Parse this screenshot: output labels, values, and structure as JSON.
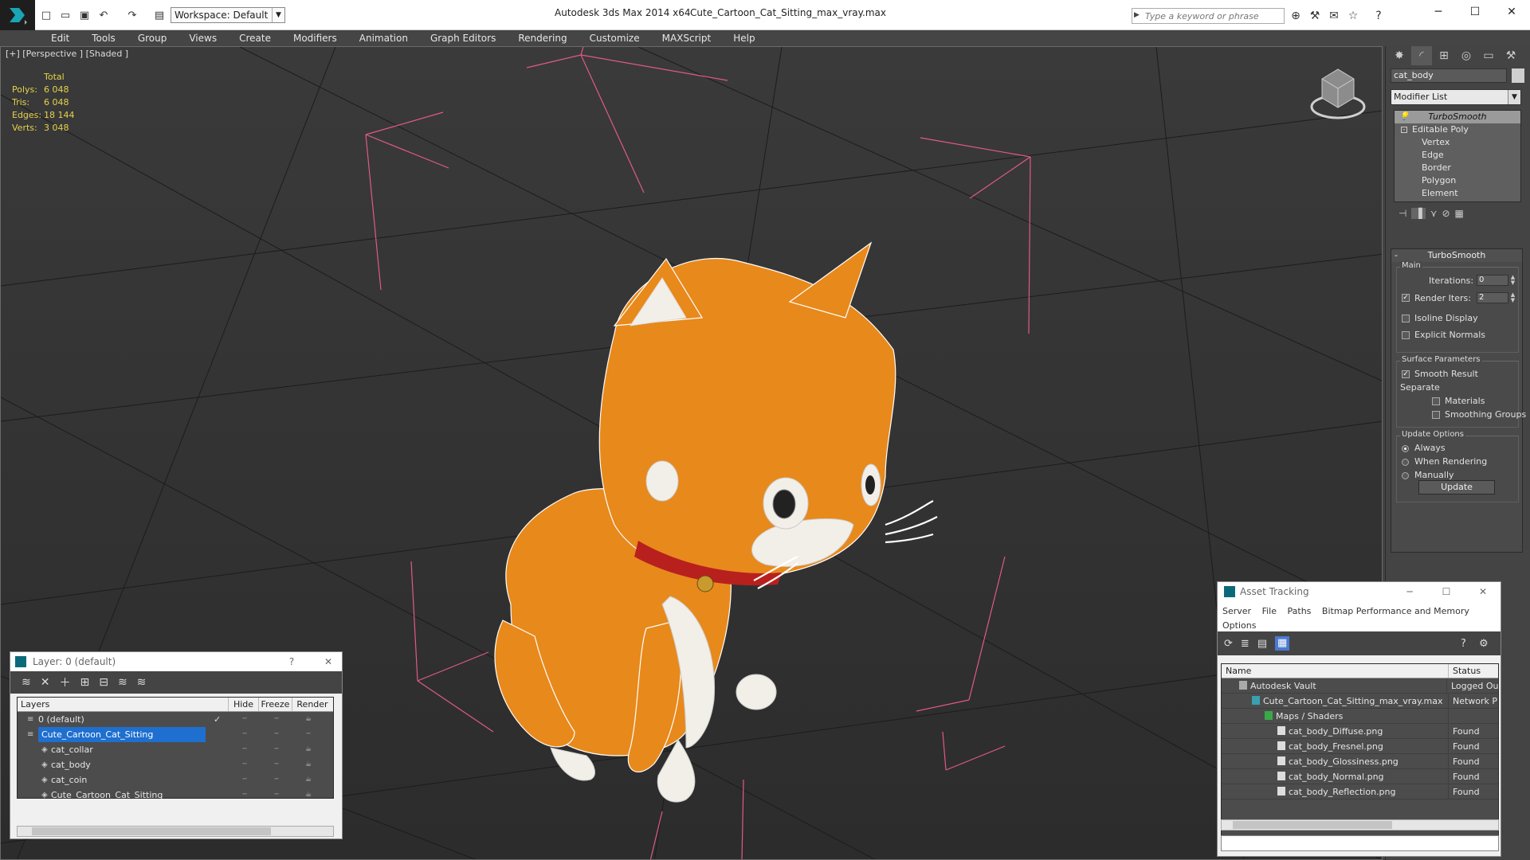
{
  "title_bar": {
    "app_title": "Autodesk 3ds Max  2014 x64",
    "file_title": "Cute_Cartoon_Cat_Sitting_max_vray.max",
    "workspace": "Workspace: Default",
    "search_placeholder": "Type a keyword or phrase"
  },
  "menu": [
    "Edit",
    "Tools",
    "Group",
    "Views",
    "Create",
    "Modifiers",
    "Animation",
    "Graph Editors",
    "Rendering",
    "Customize",
    "MAXScript",
    "Help"
  ],
  "viewport": {
    "label": "[+] [Perspective ] [Shaded ]",
    "stats": {
      "header": "Total",
      "rows": [
        {
          "k": "Polys:",
          "v": "6 048"
        },
        {
          "k": "Tris:",
          "v": "6 048"
        },
        {
          "k": "Edges:",
          "v": "18 144"
        },
        {
          "k": "Verts:",
          "v": "3 048"
        }
      ]
    }
  },
  "command_panel": {
    "object_name": "cat_body",
    "modifier_list": "Modifier List",
    "stack": {
      "selected": "TurboSmooth",
      "base": "Editable Poly",
      "subs": [
        "Vertex",
        "Edge",
        "Border",
        "Polygon",
        "Element"
      ]
    },
    "turbosmooth": {
      "title": "TurboSmooth",
      "main_group": "Main",
      "iterations_label": "Iterations:",
      "iterations_value": "0",
      "render_iters_label": "Render Iters:",
      "render_iters_value": "2",
      "isoline_label": "Isoline Display",
      "explicit_normals_label": "Explicit Normals",
      "surface_group": "Surface Parameters",
      "smooth_result_label": "Smooth Result",
      "separate_label": "Separate",
      "materials_label": "Materials",
      "smoothing_groups_label": "Smoothing Groups",
      "update_group": "Update Options",
      "always_label": "Always",
      "when_rendering_label": "When Rendering",
      "manually_label": "Manually",
      "update_button": "Update"
    }
  },
  "layer_window": {
    "title": "Layer: 0 (default)",
    "columns": [
      "Layers",
      "Hide",
      "Freeze",
      "Render"
    ],
    "rows": [
      {
        "name": "0 (default)",
        "child": false
      },
      {
        "name": "Cute_Cartoon_Cat_Sitting",
        "child": false
      },
      {
        "name": "cat_collar",
        "child": true
      },
      {
        "name": "cat_body",
        "child": true
      },
      {
        "name": "cat_coin",
        "child": true
      },
      {
        "name": "Cute_Cartoon_Cat_Sitting",
        "child": true
      }
    ]
  },
  "asset_window": {
    "title": "Asset Tracking",
    "menu": [
      "Server",
      "File",
      "Paths",
      "Bitmap Performance and Memory",
      "Options"
    ],
    "columns": [
      "Name",
      "Status"
    ],
    "rows": [
      {
        "name": "Autodesk Vault",
        "status": "Logged Ou",
        "indent": 1,
        "icon": "vault"
      },
      {
        "name": "Cute_Cartoon_Cat_Sitting_max_vray.max",
        "status": "Network P",
        "indent": 2,
        "icon": "max"
      },
      {
        "name": "Maps / Shaders",
        "status": "",
        "indent": 3,
        "icon": "maps"
      },
      {
        "name": "cat_body_Diffuse.png",
        "status": "Found",
        "indent": 4,
        "icon": "file"
      },
      {
        "name": "cat_body_Fresnel.png",
        "status": "Found",
        "indent": 4,
        "icon": "file"
      },
      {
        "name": "cat_body_Glossiness.png",
        "status": "Found",
        "indent": 4,
        "icon": "file"
      },
      {
        "name": "cat_body_Normal.png",
        "status": "Found",
        "indent": 4,
        "icon": "file"
      },
      {
        "name": "cat_body_Reflection.png",
        "status": "Found",
        "indent": 4,
        "icon": "file"
      }
    ]
  },
  "colors": {
    "accent": "#1e6fcf",
    "stats": "#e6d24b",
    "cat_orange": "#e8891c",
    "box_pink": "#e05a86"
  }
}
